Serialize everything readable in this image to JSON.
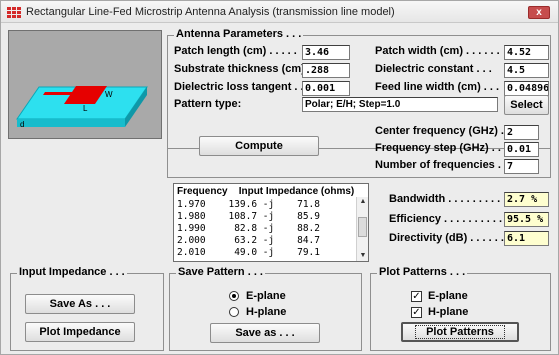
{
  "window": {
    "title": "Rectangular Line-Fed Microstrip Antenna Analysis (transmission line model)",
    "close_label": "x"
  },
  "antenna_image": {
    "label_w": "W",
    "label_l": "L",
    "label_d": "d",
    "colors": {
      "background": "#a9a9a9",
      "substrate": "#2de0ef",
      "patch": "#e60000"
    }
  },
  "antenna_parameters": {
    "legend": "Antenna Parameters . . .",
    "patch_length_label": "Patch length (cm) . . . . .",
    "patch_length_value": "3.46",
    "patch_width_label": "Patch width (cm) . . . . . .",
    "patch_width_value": "4.52",
    "substrate_thickness_label": "Substrate thickness (cm)",
    "substrate_thickness_value": ".288",
    "dielectric_constant_label": "Dielectric constant . . .",
    "dielectric_constant_value": "4.5",
    "dielectric_loss_label": "Dielectric loss tangent . .",
    "dielectric_loss_value": "0.001",
    "feed_line_width_label": "Feed line width (cm) . . .",
    "feed_line_width_value": "0.04896",
    "pattern_type_label": "Pattern type:",
    "pattern_type_value": "Polar; E/H; Step=1.0",
    "select_label": "Select"
  },
  "compute": {
    "compute_label": "Compute",
    "center_freq_label": "Center frequency (GHz) .",
    "center_freq_value": "2",
    "freq_step_label": "Frequency step (GHz) . .",
    "freq_step_value": "0.01",
    "num_freq_label": "Number of frequencies . .",
    "num_freq_value": "7"
  },
  "impedance_list": {
    "header_frequency": "Frequency",
    "header_impedance": "Input Impedance (ohms)",
    "rows": [
      "1.970    139.6 -j    71.8",
      "1.980    108.7 -j    85.9",
      "1.990     82.8 -j    88.2",
      "2.000     63.2 -j    84.7",
      "2.010     49.0 -j    79.1"
    ]
  },
  "results": {
    "bandwidth_label": "Bandwidth . . . . . . . . . .",
    "bandwidth_value": "2.7 %",
    "efficiency_label": "Efficiency . . . . . . . . . . .",
    "efficiency_value": "95.5 %",
    "directivity_label": "Directivity (dB) . . . . . .",
    "directivity_value": "6.1"
  },
  "input_impedance": {
    "legend": "Input Impedance . . .",
    "save_as_label": "Save As . . .",
    "plot_impedance_label": "Plot Impedance"
  },
  "save_pattern": {
    "legend": "Save Pattern . . .",
    "e_plane_label": "E-plane",
    "h_plane_label": "H-plane",
    "save_as_label": "Save as . . ."
  },
  "plot_patterns": {
    "legend": "Plot Patterns . . .",
    "e_plane_label": "E-plane",
    "h_plane_label": "H-plane",
    "plot_patterns_label": "Plot Patterns"
  }
}
